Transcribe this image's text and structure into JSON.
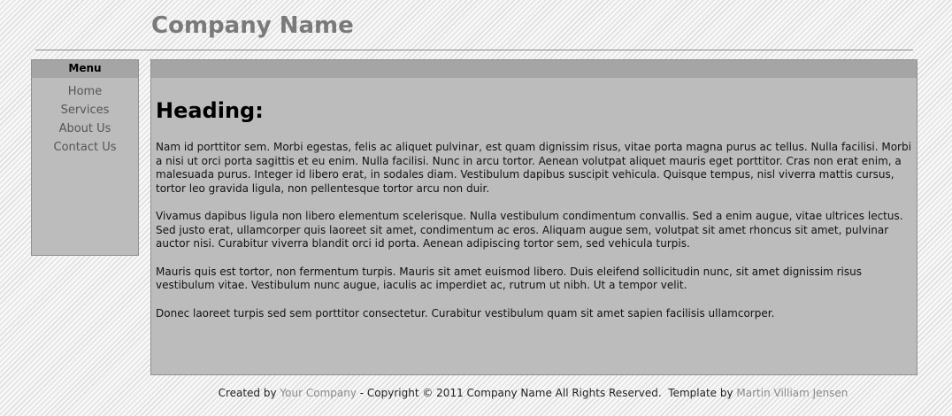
{
  "header": {
    "site_title": "Company Name"
  },
  "sidebar": {
    "title": "Menu",
    "items": [
      {
        "label": "Home"
      },
      {
        "label": "Services"
      },
      {
        "label": "About Us"
      },
      {
        "label": "Contact Us"
      }
    ]
  },
  "main": {
    "heading": "Heading:",
    "paragraphs": [
      "Nam id porttitor sem. Morbi egestas, felis ac aliquet pulvinar, est quam dignissim risus, vitae porta magna purus ac tellus. Nulla facilisi. Morbi a nisi ut orci porta sagittis et eu enim. Nulla facilisi. Nunc in arcu tortor. Aenean volutpat aliquet mauris eget porttitor. Cras non erat enim, a malesuada purus. Integer id libero erat, in sodales diam. Vestibulum dapibus suscipit vehicula. Quisque tempus, nisl viverra mattis cursus, tortor leo gravida ligula, non pellentesque tortor arcu non duir.",
      "Vivamus dapibus ligula non libero elementum scelerisque. Nulla vestibulum condimentum convallis. Sed a enim augue, vitae ultrices lectus. Sed justo erat, ullamcorper quis laoreet sit amet, condimentum ac eros. Aliquam augue sem, volutpat sit amet rhoncus sit amet, pulvinar auctor nisi. Curabitur viverra blandit orci id porta. Aenean adipiscing tortor sem, sed vehicula turpis.",
      "Mauris quis est tortor, non fermentum turpis. Mauris sit amet euismod libero. Duis eleifend sollicitudin nunc, sit amet dignissim risus vestibulum vitae. Vestibulum nunc augue, iaculis ac imperdiet ac, rutrum ut nibh. Ut a tempor velit.",
      "Donec laoreet turpis sed sem porttitor consectetur. Curabitur vestibulum quam sit amet sapien facilisis ullamcorper."
    ]
  },
  "footer": {
    "created_by_prefix": "Created by",
    "created_by_link": "Your Company",
    "copyright_text": " - Copyright © 2011 Company Name All Rights Reserved.  Template by ",
    "template_by_link": "Martin Villiam Jensen"
  },
  "colors": {
    "title_gray": "#7a7a7a",
    "panel_bg": "#bcbcbc",
    "panel_header_bg": "#a5a5a5",
    "link_gray": "#8a8a8a"
  }
}
